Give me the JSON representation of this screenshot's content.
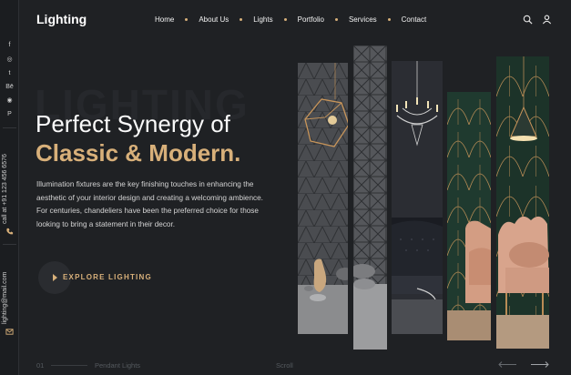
{
  "brand": {
    "logo": "Lighting",
    "accent": "#d8b07a"
  },
  "nav": {
    "items": [
      "Home",
      "About Us",
      "Lights",
      "Portfolio",
      "Services",
      "Contact"
    ]
  },
  "header_icons": [
    "search-icon",
    "user-icon"
  ],
  "sidebar": {
    "social": [
      "f",
      "◎",
      "t",
      "Bē",
      "◉",
      "P"
    ],
    "phone": "call at +91 123 456 6576",
    "email": "lighting@mail.com"
  },
  "hero": {
    "watermark": "LIGHTING",
    "title_line1": "Perfect Synergy of",
    "title_line2": "Classic & Modern.",
    "description": "Illumination fixtures are the key finishing touches in enhancing the aesthetic of your interior design and creating a welcoming ambience. For centuries, chandeliers have been the preferred choice for those looking to bring a statement in their decor.",
    "cta_label": "EXPLORE LIGHTING"
  },
  "footer": {
    "index": "01",
    "caption": "Pendant Lights",
    "scroll": "Scroll"
  }
}
